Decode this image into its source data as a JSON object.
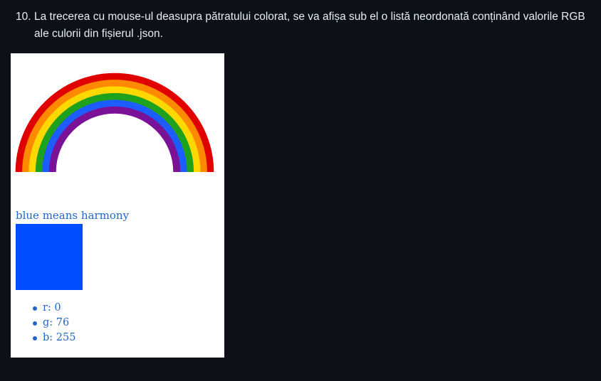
{
  "instruction": {
    "number": "10.",
    "text": "La trecerea cu mouse-ul deasupra pătratului colorat, se va afișa sub el o listă neordonată conținând valorile RGB ale culorii din fișierul .json."
  },
  "demo": {
    "heading": "blue means harmony",
    "square_color": "#004cff",
    "rainbow_colors": [
      "#e00000",
      "#ff8a00",
      "#ffd800",
      "#1ea21e",
      "#1d5cff",
      "#7a1196"
    ],
    "rgb_list": [
      {
        "label": "r: 0"
      },
      {
        "label": "g: 76"
      },
      {
        "label": "b: 255"
      }
    ]
  }
}
